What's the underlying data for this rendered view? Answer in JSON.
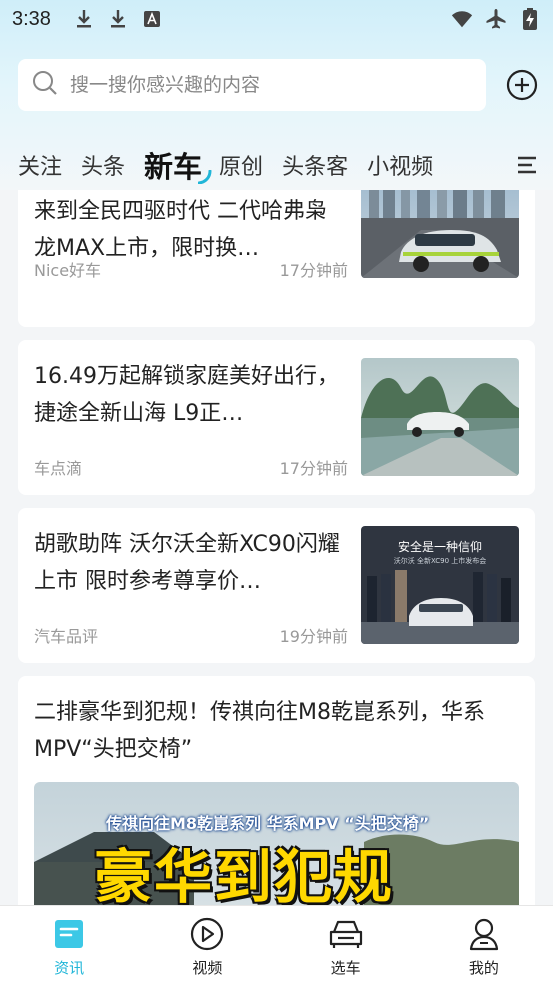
{
  "status_bar": {
    "time": "3:38",
    "left_icons": [
      "download-icon",
      "download-icon",
      "font-icon"
    ],
    "right_icons": [
      "wifi-icon",
      "airplane-icon",
      "battery-charging-icon"
    ]
  },
  "search": {
    "placeholder": "搜一搜你感兴趣的内容"
  },
  "tabs": [
    {
      "label": "关注",
      "active": false
    },
    {
      "label": "头条",
      "active": false
    },
    {
      "label": "新车",
      "active": true
    },
    {
      "label": "原创",
      "active": false
    },
    {
      "label": "头条客",
      "active": false
    },
    {
      "label": "小视频",
      "active": false
    }
  ],
  "feed": [
    {
      "title": "来到全民四驱时代 二代哈弗枭龙MAX上市，限时换…",
      "source": "Nice好车",
      "time": "17分钟前"
    },
    {
      "title": "16.49万起解锁家庭美好出行， 捷途全新山海 L9正…",
      "source": "车点滴",
      "time": "17分钟前"
    },
    {
      "title": "胡歌助阵 沃尔沃全新XC90闪耀上市 限时参考尊享价…",
      "source": "汽车品评",
      "time": "19分钟前",
      "image_text": {
        "line1": "安全是一种信仰",
        "line2": "沃尔沃 全新XC90 上市发布会"
      }
    },
    {
      "title": "二排豪华到犯规！传祺向往M8乾崑系列，华系MPV“头把交椅”",
      "image_text": {
        "banner": "传祺向往M8乾崑系列 华系MPV “头把交椅”",
        "headline": "豪华到犯规"
      }
    }
  ],
  "bottom_nav": [
    {
      "label": "资讯",
      "icon": "news-icon",
      "active": true
    },
    {
      "label": "视频",
      "icon": "play-video-icon",
      "active": false
    },
    {
      "label": "选车",
      "icon": "car-icon",
      "active": false
    },
    {
      "label": "我的",
      "icon": "profile-icon",
      "active": false
    }
  ],
  "colors": {
    "accent": "#20b6d8",
    "text": "#222222",
    "meta": "#999999"
  }
}
